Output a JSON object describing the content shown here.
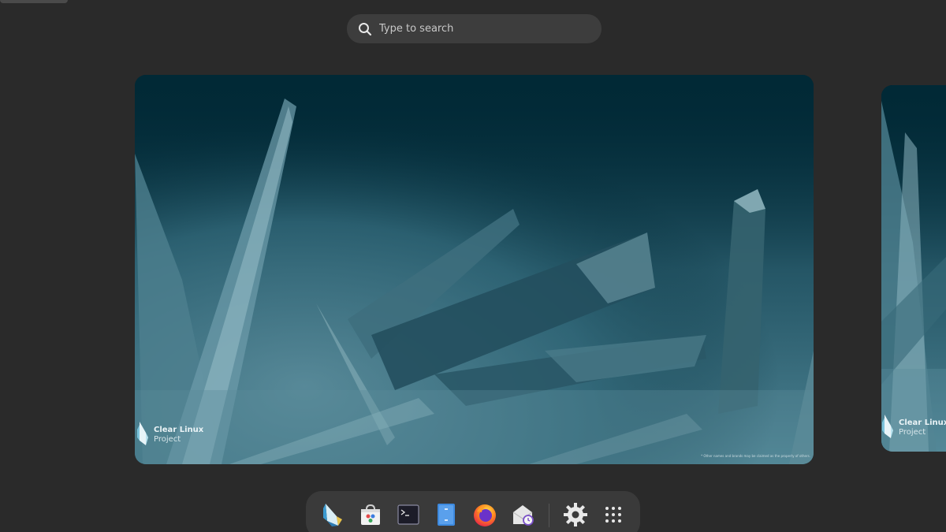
{
  "search": {
    "placeholder": "Type to search"
  },
  "workspaces": [
    {
      "brand_line1": "Clear Linux",
      "brand_line2": "Project",
      "footnote": "* Other names and brands may be claimed as the property of others."
    },
    {
      "brand_line1": "Clear Linux",
      "brand_line2": "Project"
    }
  ],
  "dash": {
    "apps": [
      {
        "icon": "clear-linux-icon"
      },
      {
        "icon": "software-store-icon"
      },
      {
        "icon": "terminal-icon"
      },
      {
        "icon": "files-icon"
      },
      {
        "icon": "firefox-icon"
      },
      {
        "icon": "mail-clock-icon"
      },
      {
        "icon": "settings-icon"
      },
      {
        "icon": "app-grid-icon"
      }
    ]
  },
  "colors": {
    "background": "#2a2a2a",
    "search_bg": "#3d3d3d",
    "wallpaper_dark": "#012936",
    "dash_bg": "#3a3a3a"
  }
}
